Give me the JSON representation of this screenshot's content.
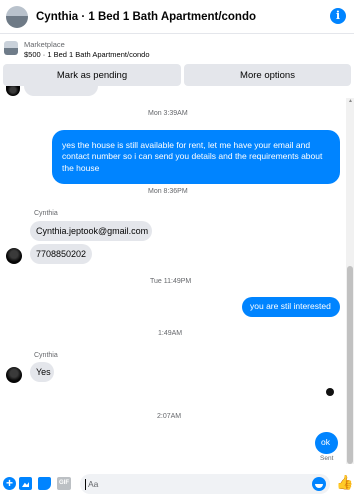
{
  "header": {
    "title": "Cynthia · 1 Bed 1 Bath Apartment/condo",
    "info_glyph": "i",
    "avatar_icon": "listing-photo-icon",
    "info_icon": "info-icon"
  },
  "listing": {
    "source": "Marketplace",
    "detail": "$500 · 1 Bed 1 Bath Apartment/condo"
  },
  "actions": {
    "mark_pending": "Mark as pending",
    "more_options": "More options"
  },
  "messages": {
    "ts1": "Mon 3:39AM",
    "out1": "yes the house is still available for rent, let me have your email  and contact number so i can send you details and the requirements about the house",
    "ts2": "Mon 8:36PM",
    "sender1": "Cynthia",
    "in1": "Cynthia.jeptook@gmail.com",
    "in2": "7708850202",
    "ts3": "Tue 11:49PM",
    "out2": "you are stil interested",
    "ts4": "1:49AM",
    "sender2": "Cynthia",
    "in3": "Yes",
    "ts5": "2:07AM",
    "out3": "ok",
    "status": "Sent"
  },
  "composer": {
    "placeholder": "Aa",
    "plus_glyph": "+",
    "gif_label": "GIF",
    "like_glyph": "👍",
    "icons": [
      "add-icon",
      "photo-icon",
      "sticker-icon",
      "gif-icon",
      "emoji-icon",
      "thumbs-up-icon"
    ]
  },
  "colors": {
    "accent": "#0084ff",
    "incoming_bubble": "#e4e6eb",
    "muted_text": "#65676b"
  }
}
